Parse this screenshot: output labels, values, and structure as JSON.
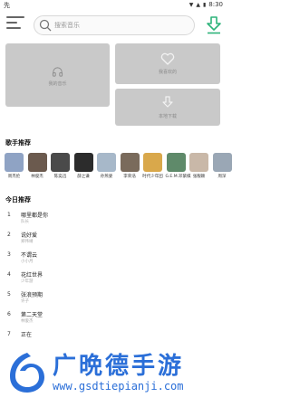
{
  "status_bar": {
    "left_text": "先",
    "time": "8:30",
    "icons": [
      "wifi-icon",
      "signal-icon",
      "battery-icon"
    ]
  },
  "search": {
    "placeholder": "搜索音乐",
    "value": ""
  },
  "tiles": {
    "my_music": "我的音乐",
    "favorites": "我喜欢的",
    "local_download": "本地下载"
  },
  "singers_section": {
    "title": "歌手推荐",
    "singers": [
      {
        "name": "周杰伦",
        "color": "#8fa3c4"
      },
      {
        "name": "林俊杰",
        "color": "#6b5a4e"
      },
      {
        "name": "陈奕迅",
        "color": "#4a4a4a"
      },
      {
        "name": "薛之谦",
        "color": "#2c2c2c"
      },
      {
        "name": "孙燕姿",
        "color": "#a7b8c9"
      },
      {
        "name": "李荣浩",
        "color": "#7a6b5c"
      },
      {
        "name": "时代少年团",
        "color": "#d9a84b"
      },
      {
        "name": "G.E.M.邓紫棋",
        "color": "#5f8a6a"
      },
      {
        "name": "张靓颖",
        "color": "#c9b8a8"
      },
      {
        "name": "周深",
        "color": "#9aa7b5"
      }
    ]
  },
  "songs_section": {
    "title": "今日推荐",
    "songs": [
      {
        "index": "1",
        "title": "哪里都是你",
        "artist": "队长"
      },
      {
        "index": "2",
        "title": "说好爱",
        "artist": "郑伟靖"
      },
      {
        "index": "3",
        "title": "不谓云",
        "artist": "小小月"
      },
      {
        "index": "4",
        "title": "花红世界",
        "artist": "少年游"
      },
      {
        "index": "5",
        "title": "张浪预期",
        "artist": "许子"
      },
      {
        "index": "6",
        "title": "第二天堂",
        "artist": "林俊杰"
      },
      {
        "index": "7",
        "title": "正在",
        "artist": ""
      }
    ]
  },
  "watermark": {
    "title": "广晩德手游",
    "url": "www.gsdtiepianji.com"
  },
  "colors": {
    "accent_green": "#2db37a",
    "tile_gray": "#c9c9c9",
    "watermark_blue": "#2b6fd8"
  }
}
